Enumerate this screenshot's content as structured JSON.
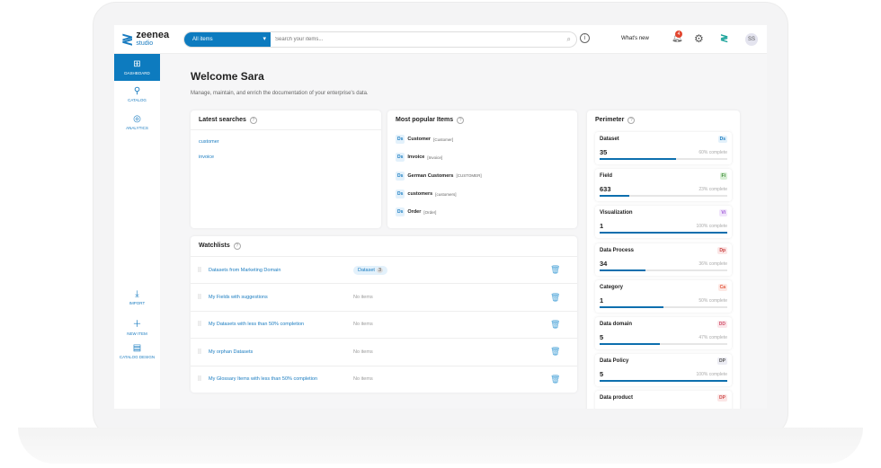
{
  "brand": {
    "name": "zeenea",
    "sub": "studio"
  },
  "topbar": {
    "scope": "All items",
    "search_placeholder": "Search your items...",
    "whats_new": "What's new",
    "notifications": "4",
    "avatar": "SS"
  },
  "sidebar": {
    "items": [
      {
        "label": "DASHBOARD",
        "icon": "dashboard-icon"
      },
      {
        "label": "CATALOG",
        "icon": "catalog-icon"
      },
      {
        "label": "ANALYTICS",
        "icon": "analytics-icon"
      }
    ],
    "bottom": [
      {
        "label": "IMPORT",
        "icon": "import-icon"
      },
      {
        "label": "NEW ITEM",
        "icon": "plus-icon"
      },
      {
        "label": "CATALOG DESIGN",
        "icon": "catalog-design-icon"
      }
    ]
  },
  "main": {
    "title": "Welcome Sara",
    "subtitle": "Manage, maintain, and enrich the documentation of your enterprise's data.",
    "latest": {
      "title": "Latest searches",
      "items": [
        "customer",
        "invoice"
      ]
    },
    "popular": {
      "title": "Most popular Items",
      "items": [
        {
          "tag": "Ds",
          "name": "Customer",
          "key": "[Customer]"
        },
        {
          "tag": "Ds",
          "name": "Invoice",
          "key": "[Invoice]"
        },
        {
          "tag": "Ds",
          "name": "German Customers",
          "key": "[CUSTOMER]"
        },
        {
          "tag": "Ds",
          "name": "customers",
          "key": "[customers]"
        },
        {
          "tag": "Ds",
          "name": "Order",
          "key": "[Order]"
        }
      ]
    },
    "watchlists": {
      "title": "Watchlists",
      "items": [
        {
          "name": "Datasets from Marketing Domain",
          "status": "",
          "chip": "Dataset",
          "count": "3"
        },
        {
          "name": "My Fields with suggestions",
          "status": "No items"
        },
        {
          "name": "My Datasets with less than 50% completion",
          "status": "No items"
        },
        {
          "name": "My orphan Datasets",
          "status": "No items"
        },
        {
          "name": "My Glossary Items with less than 50% completion",
          "status": "No items"
        }
      ]
    },
    "perimeter": {
      "title": "Perimeter",
      "items": [
        {
          "label": "Dataset",
          "tag": "Ds",
          "value": "35",
          "pct_text": "60% complete",
          "pct": 60,
          "bg": "#e3f1fb",
          "fg": "#1a7cc0"
        },
        {
          "label": "Field",
          "tag": "Fi",
          "value": "633",
          "pct_text": "23% complete",
          "pct": 23,
          "bg": "#d8efd5",
          "fg": "#3a8a35"
        },
        {
          "label": "Visualization",
          "tag": "Vi",
          "value": "1",
          "pct_text": "100% complete",
          "pct": 100,
          "bg": "#f1e6fb",
          "fg": "#9a4fd6"
        },
        {
          "label": "Data Process",
          "tag": "Dp",
          "value": "34",
          "pct_text": "36% complete",
          "pct": 36,
          "bg": "#fbe6e6",
          "fg": "#c73b3b"
        },
        {
          "label": "Category",
          "tag": "Ca",
          "value": "1",
          "pct_text": "50% complete",
          "pct": 50,
          "bg": "#fde8e4",
          "fg": "#e2553b"
        },
        {
          "label": "Data domain",
          "tag": "DD",
          "value": "5",
          "pct_text": "47% complete",
          "pct": 47,
          "bg": "#fbe6ea",
          "fg": "#d0506a"
        },
        {
          "label": "Data Policy",
          "tag": "DP",
          "value": "5",
          "pct_text": "100% complete",
          "pct": 100,
          "bg": "#ececf3",
          "fg": "#555"
        },
        {
          "label": "Data product",
          "tag": "DP",
          "value": "",
          "pct_text": "",
          "pct": 0,
          "bg": "#fbe6e6",
          "fg": "#d05050"
        }
      ]
    }
  }
}
